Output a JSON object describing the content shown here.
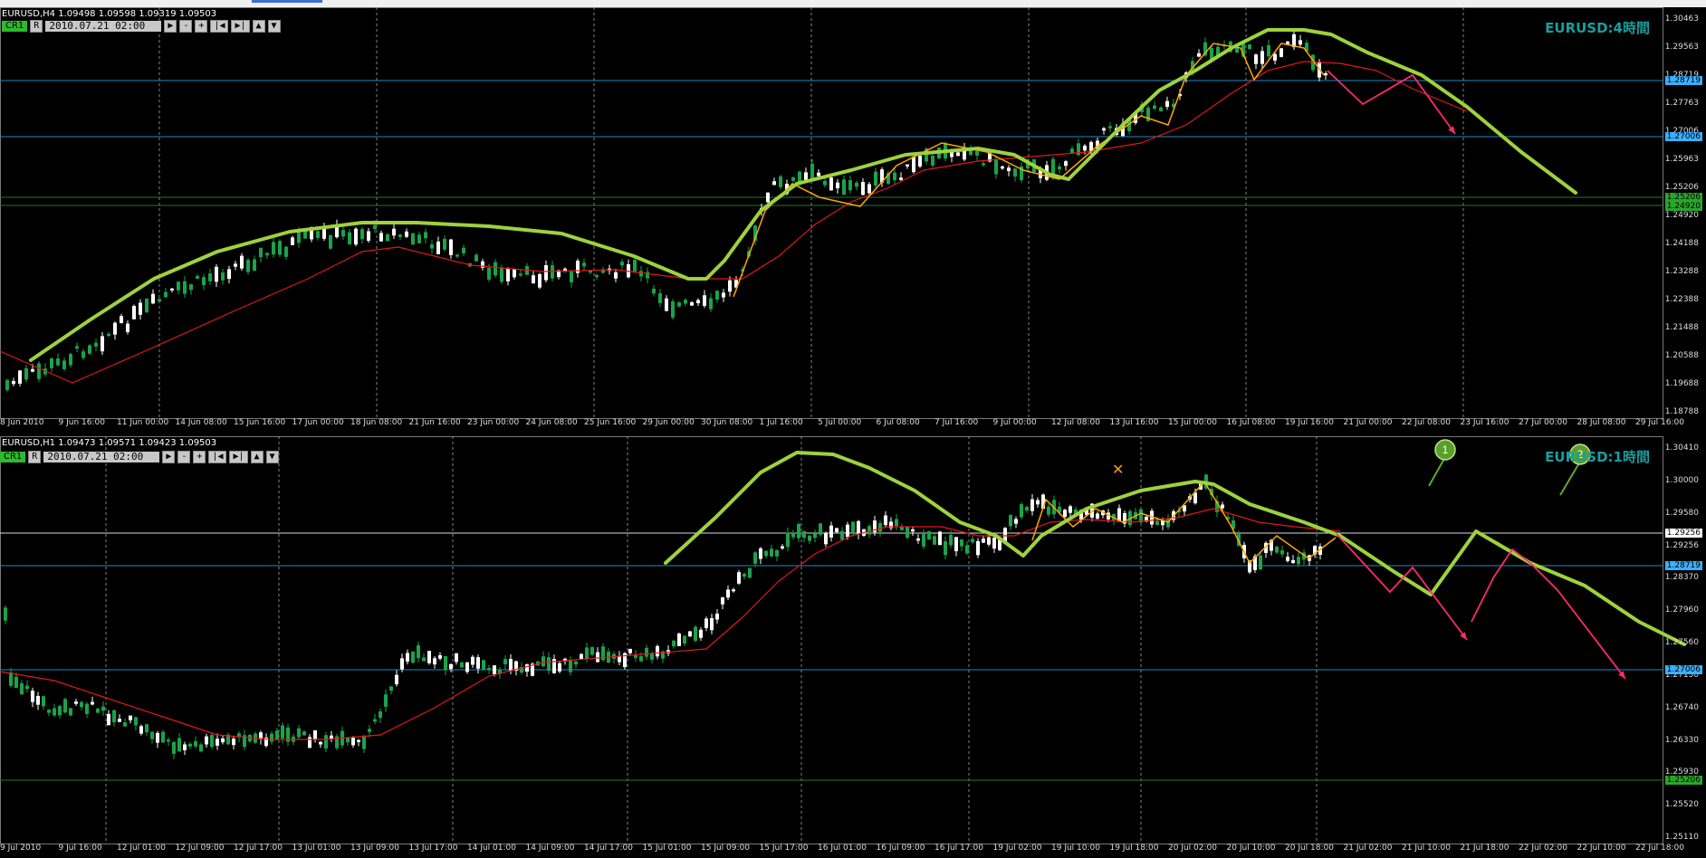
{
  "top_chart": {
    "header": "EURUSD,H4  1.09498 1.09598 1.09319 1.09503",
    "toolbar": {
      "cr": "CR1",
      "r": "R",
      "date": "2010.07.21 02:00",
      "play": "▶",
      "minus": "-",
      "plus": "+",
      "first": "|◀",
      "last": "▶|",
      "up": "▲",
      "down": "▼"
    },
    "watermark": "EURUSD:4時間",
    "price_scale": [
      "1.30463",
      "1.29563",
      "1.28719",
      "1.27763",
      "1.27006",
      "1.25963",
      "1.25206",
      "1.24920",
      "1.24188",
      "1.23288",
      "1.22388",
      "1.21488",
      "1.20588",
      "1.19688",
      "1.18788"
    ],
    "price_labels": [
      {
        "text": "1.28719",
        "color": "#3ab0ff"
      },
      {
        "text": "1.27006",
        "color": "#3ab0ff"
      },
      {
        "text": "1.25206",
        "color": "#2aa52a"
      },
      {
        "text": "1.24920",
        "color": "#2aa52a"
      }
    ],
    "time_labels": [
      "8 Jun 2010",
      "9 Jun 16:00",
      "11 Jun 00:00",
      "14 Jun 08:00",
      "15 Jun 16:00",
      "17 Jun 00:00",
      "18 Jun 08:00",
      "21 Jun 16:00",
      "23 Jun 00:00",
      "24 Jun 08:00",
      "25 Jun 16:00",
      "29 Jun 00:00",
      "30 Jun 08:00",
      "1 Jul 16:00",
      "5 Jul 00:00",
      "6 Jul 08:00",
      "7 Jul 16:00",
      "9 Jul 00:00",
      "12 Jul 08:00",
      "13 Jul 16:00",
      "15 Jul 00:00",
      "16 Jul 08:00",
      "19 Jul 16:00",
      "21 Jul 00:00",
      "22 Jul 08:00",
      "23 Jul 16:00",
      "27 Jul 00:00",
      "28 Jul 08:00",
      "29 Jul 16:00"
    ]
  },
  "bottom_chart": {
    "header": "EURUSD,H1  1.09473 1.09571 1.09423 1.09503",
    "toolbar": {
      "cr": "CR1",
      "r": "R",
      "date": "2010.07.21 02:00",
      "play": "▶",
      "minus": "-",
      "plus": "+",
      "first": "|◀",
      "last": "▶|",
      "up": "▲",
      "down": "▼"
    },
    "watermark": "EURUSD:1時間",
    "price_scale": [
      "1.30410",
      "1.30000",
      "1.29580",
      "1.29256",
      "1.28370",
      "1.27960",
      "1.27560",
      "1.27150",
      "1.26740",
      "1.26330",
      "1.25930",
      "1.25520",
      "1.25110"
    ],
    "price_labels": [
      {
        "text": "1.29256",
        "color": "#ffffff"
      },
      {
        "text": "1.28719",
        "color": "#3ab0ff"
      },
      {
        "text": "1.27006",
        "color": "#3ab0ff"
      },
      {
        "text": "1.25206",
        "color": "#2aa52a"
      }
    ],
    "annotations": [
      "1",
      "2"
    ],
    "time_labels": [
      "9 Jul 2010",
      "9 Jul 16:00",
      "12 Jul 01:00",
      "12 Jul 09:00",
      "12 Jul 17:00",
      "13 Jul 01:00",
      "13 Jul 09:00",
      "13 Jul 17:00",
      "14 Jul 01:00",
      "14 Jul 09:00",
      "14 Jul 17:00",
      "15 Jul 01:00",
      "15 Jul 09:00",
      "15 Jul 17:00",
      "16 Jul 01:00",
      "16 Jul 09:00",
      "16 Jul 17:00",
      "19 Jul 02:00",
      "19 Jul 10:00",
      "19 Jul 18:00",
      "20 Jul 02:00",
      "20 Jul 10:00",
      "20 Jul 18:00",
      "21 Jul 02:00",
      "21 Jul 10:00",
      "21 Jul 18:00",
      "22 Jul 02:00",
      "22 Jul 10:00",
      "22 Jul 18:00"
    ]
  },
  "colors": {
    "bull_candle": "#ffffff",
    "bear_candle": "#1aa34a",
    "ma_slow": "#e01818",
    "trend_curve": "#9ed23c",
    "zigzag": "#ffa500",
    "forecast": "#ff2a6d",
    "hline_blue": "#1e88c8",
    "hline_green": "#1f7a1f"
  }
}
